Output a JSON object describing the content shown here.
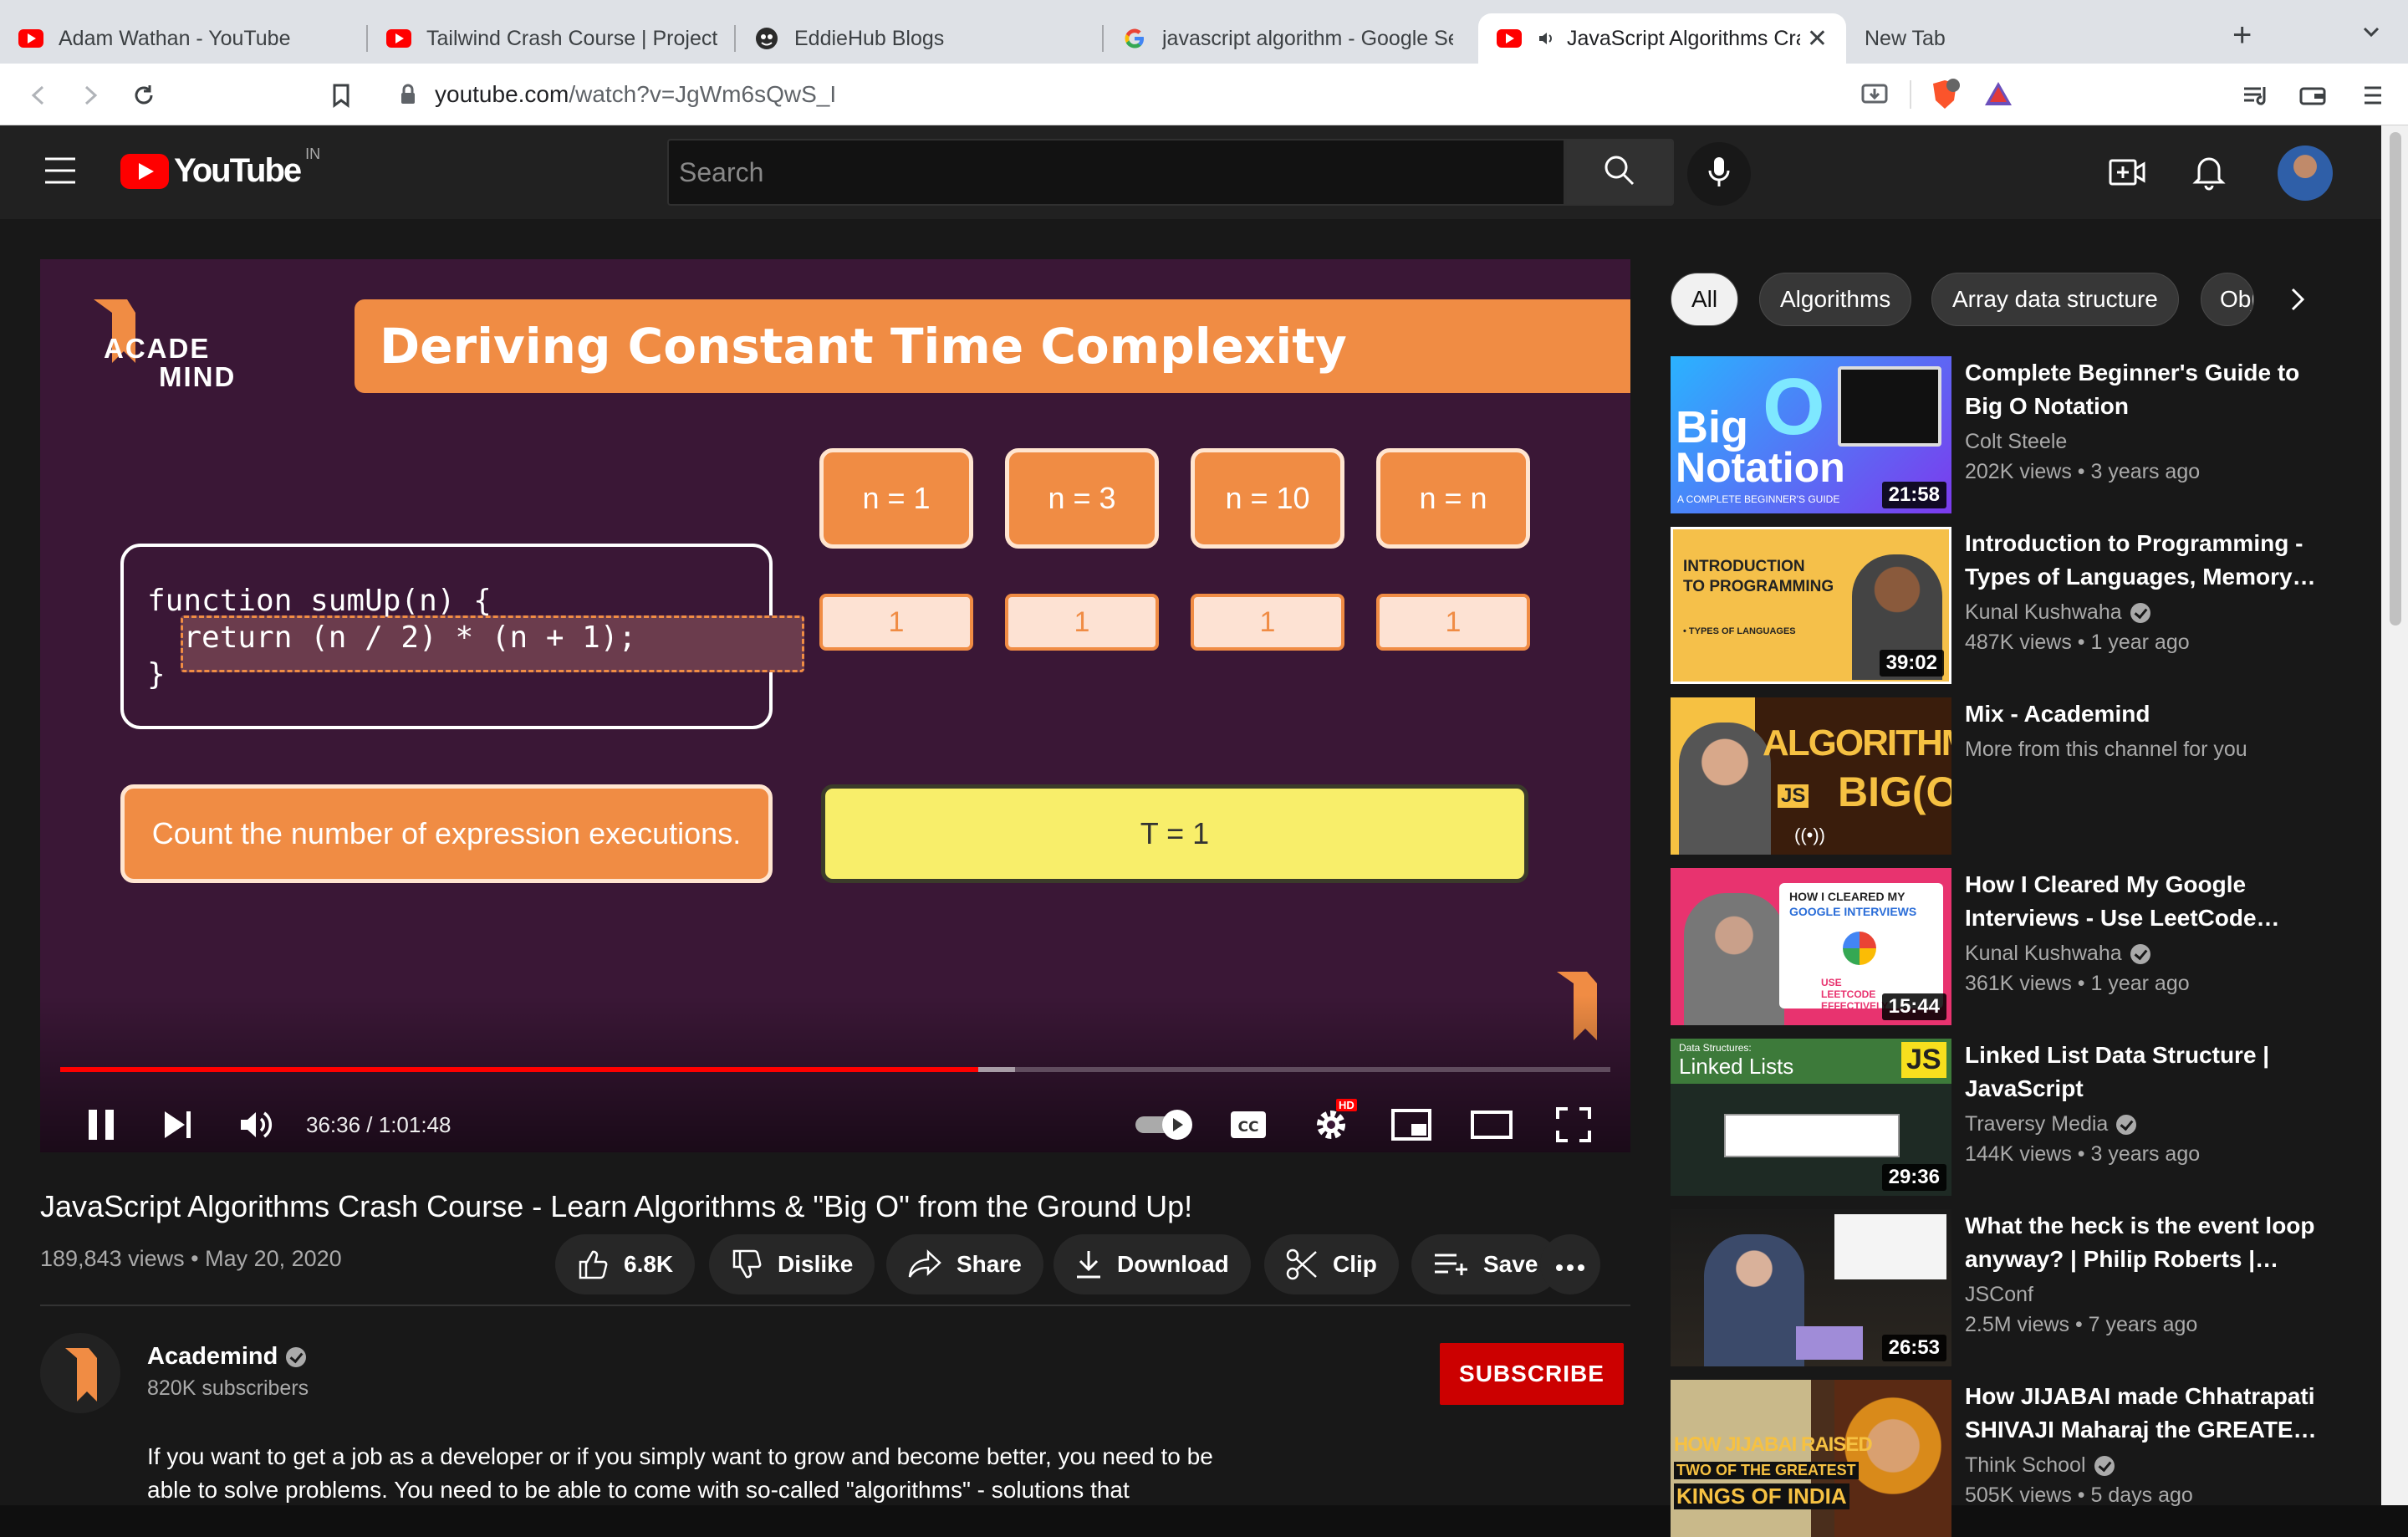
{
  "browser": {
    "tabs": [
      {
        "title": "Adam Wathan - YouTube",
        "icon": "youtube-favicon"
      },
      {
        "title": "Tailwind Crash Course | Project F",
        "icon": "youtube-favicon"
      },
      {
        "title": "EddieHub Blogs",
        "icon": "eddiehub-favicon"
      },
      {
        "title": "javascript algorithm - Google Se",
        "icon": "google-favicon"
      },
      {
        "title": "JavaScript Algorithms Cra",
        "icon": "youtube-favicon"
      },
      {
        "title": "New Tab",
        "icon": ""
      }
    ],
    "new_tab_label": "+",
    "url_host": "youtube.com",
    "url_path": "/watch?v=JgWm6sQwS_I"
  },
  "youtube": {
    "logo_text": "YouTube",
    "region": "IN",
    "search_placeholder": "Search"
  },
  "player": {
    "slide_title": "Deriving Constant Time Complexity",
    "brand_line1": "ACADE",
    "brand_line2": "MIND",
    "n_labels": [
      "n = 1",
      "n = 3",
      "n = 10",
      "n = n"
    ],
    "n_values": [
      "1",
      "1",
      "1",
      "1"
    ],
    "code_line1": "function sumUp(n) {",
    "code_line2": "  return (n / 2) * (n + 1);",
    "code_line3": "}",
    "count_label": "Count the number of expression executions.",
    "t_label": "T = 1",
    "time": "36:36 / 1:01:48",
    "progress_fraction": 0.592,
    "buffer_fraction": 0.616,
    "hd_badge": "HD"
  },
  "video": {
    "title": "JavaScript Algorithms Crash Course - Learn Algorithms & \"Big O\" from the Ground Up!",
    "views": "189,843 views",
    "date": "May 20, 2020",
    "like_count": "6.8K",
    "dislike_label": "Dislike",
    "share_label": "Share",
    "download_label": "Download",
    "clip_label": "Clip",
    "save_label": "Save",
    "channel_name": "Academind",
    "subscribers": "820K subscribers",
    "subscribe_label": "SUBSCRIBE",
    "description": "If you want to get a job as a developer or if you simply want to grow and become better, you need to be able to solve problems. You need to be able to come with so-called \"algorithms\" - solutions that"
  },
  "chips": [
    "All",
    "Algorithms",
    "Array data structure",
    "Obj"
  ],
  "recommendations": [
    {
      "title": "Complete Beginner's Guide to Big O Notation",
      "channel": "Colt Steele",
      "meta": "202K views • 3 years ago",
      "duration": "21:58",
      "verified": false,
      "thumb_text1": "Big",
      "thumb_text2": "Notation",
      "thumb_text3": "A COMPLETE BEGINNER'S GUIDE"
    },
    {
      "title": "Introduction to Programming - Types of Languages, Memory…",
      "channel": "Kunal Kushwaha",
      "meta": "487K views • 1 year ago",
      "duration": "39:02",
      "verified": true,
      "thumb_text1": "INTRODUCTION",
      "thumb_text2": "TO PROGRAMMING",
      "thumb_text3": "• TYPES OF LANGUAGES"
    },
    {
      "title": "Mix - Academind",
      "channel": "More from this channel for you",
      "meta": "",
      "duration": "",
      "verified": false,
      "thumb_text1": "ALGORITHMS",
      "thumb_text2": "BIG(O)",
      "thumb_text3": "JS"
    },
    {
      "title": "How I Cleared My Google Interviews - Use LeetCode…",
      "channel": "Kunal Kushwaha",
      "meta": "361K views • 1 year ago",
      "duration": "15:44",
      "verified": true,
      "thumb_text1": "HOW I CLEARED MY",
      "thumb_text2": "GOOGLE INTERVIEWS",
      "thumb_text3": "USE LEETCODE EFFECTIVELY"
    },
    {
      "title": "Linked List Data Structure | JavaScript",
      "channel": "Traversy Media",
      "meta": "144K views • 3 years ago",
      "duration": "29:36",
      "verified": true,
      "thumb_text1": "Data Structures:",
      "thumb_text2": "Linked Lists",
      "thumb_text3": "JS"
    },
    {
      "title": "What the heck is the event loop anyway? | Philip Roberts |…",
      "channel": "JSConf",
      "meta": "2.5M views • 7 years ago",
      "duration": "26:53",
      "verified": false,
      "thumb_text1": "",
      "thumb_text2": "",
      "thumb_text3": ""
    },
    {
      "title": "How JIJABAI made Chhatrapati SHIVAJI Maharaj the GREATE…",
      "channel": "Think School",
      "meta": "505K views • 5 days ago",
      "duration": "",
      "verified": true,
      "thumb_text1": "HOW JIJABAI RAISED",
      "thumb_text2": "TWO OF THE GREATEST",
      "thumb_text3": "KINGS OF INDIA"
    }
  ],
  "colors": {
    "accent_red": "#ff0000",
    "slide_orange": "#f08c44",
    "slide_bg": "#3a1736"
  }
}
